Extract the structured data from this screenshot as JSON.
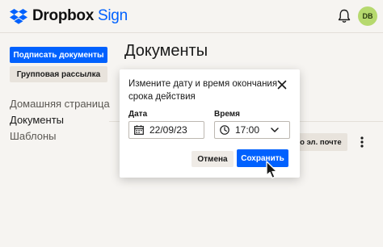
{
  "header": {
    "brand": "Dropbox",
    "brand_product": "Sign",
    "avatar_initials": "DB"
  },
  "sidebar": {
    "sign_button": "Подписать документы",
    "bulk_button": "Групповая рассылка",
    "nav": [
      {
        "label": "Домашняя страница"
      },
      {
        "label": "Документы"
      },
      {
        "label": "Шаблоны"
      }
    ]
  },
  "main": {
    "title": "Документы",
    "row_action_label": "по эл. почте"
  },
  "modal": {
    "title": "Измените дату и время окончания срока действия",
    "date_label": "Дата",
    "date_value": "22/09/23",
    "time_label": "Время",
    "time_value": "17:00",
    "cancel_label": "Отмена",
    "save_label": "Сохранить"
  },
  "colors": {
    "accent": "#0061fe",
    "background": "#f6f4f1",
    "avatar": "#b6d96e"
  },
  "icons": [
    "dropbox-logo",
    "bell-icon",
    "kebab-icon",
    "close-icon",
    "calendar-icon",
    "clock-icon",
    "chevron-down-icon",
    "cursor-icon"
  ]
}
